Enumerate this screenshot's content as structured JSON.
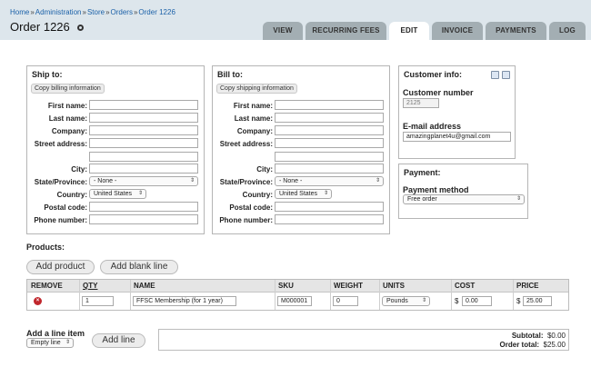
{
  "breadcrumb": [
    "Home",
    "Administration",
    "Store",
    "Orders",
    "Order 1226"
  ],
  "page": {
    "title": "Order 1226"
  },
  "tabs": [
    {
      "label": "VIEW",
      "active": false
    },
    {
      "label": "RECURRING FEES",
      "active": false
    },
    {
      "label": "EDIT",
      "active": true
    },
    {
      "label": "INVOICE",
      "active": false
    },
    {
      "label": "PAYMENTS",
      "active": false
    },
    {
      "label": "LOG",
      "active": false
    }
  ],
  "ship_to": {
    "title": "Ship to:",
    "copy_button": "Copy billing information",
    "labels": {
      "first_name": "First name:",
      "last_name": "Last name:",
      "company": "Company:",
      "street": "Street address:",
      "city": "City:",
      "state": "State/Province:",
      "country": "Country:",
      "postal": "Postal code:",
      "phone": "Phone number:"
    },
    "state_value": "- None -",
    "country_value": "United States"
  },
  "bill_to": {
    "title": "Bill to:",
    "copy_button": "Copy shipping information",
    "labels": {
      "first_name": "First name:",
      "last_name": "Last name:",
      "company": "Company:",
      "street": "Street address:",
      "city": "City:",
      "state": "State/Province:",
      "country": "Country:",
      "postal": "Postal code:",
      "phone": "Phone number:"
    },
    "state_value": "- None -",
    "country_value": "United States"
  },
  "customer_info": {
    "title": "Customer info:",
    "number_label": "Customer number",
    "number_value": "2125",
    "email_label": "E-mail address",
    "email_value": "amazingplanet4u@gmail.com"
  },
  "payment": {
    "title": "Payment:",
    "method_label": "Payment method",
    "method_value": "Free order"
  },
  "products": {
    "title": "Products:",
    "add_product": "Add product",
    "add_blank_line": "Add blank line",
    "columns": {
      "remove": "REMOVE",
      "qty": "QTY",
      "name": "NAME",
      "sku": "SKU",
      "weight": "WEIGHT",
      "units": "UNITS",
      "cost": "COST",
      "price": "PRICE"
    },
    "rows": [
      {
        "qty": "1",
        "name": "FFSC Membership (for 1 year)",
        "sku": "M000001",
        "weight": "0",
        "units": "Pounds",
        "currency": "$",
        "cost": "0.00",
        "price": "25.00"
      }
    ]
  },
  "line_item": {
    "title": "Add a line item",
    "type_value": "Empty line",
    "add_line": "Add line"
  },
  "totals": {
    "subtotal_label": "Subtotal:",
    "subtotal_value": "$0.00",
    "order_total_label": "Order total:",
    "order_total_value": "$25.00"
  },
  "colors": {
    "header_bg": "#dde6ec",
    "link": "#1b61a8",
    "tab_inactive": "#a3aeb3",
    "remove": "#c1272d"
  }
}
